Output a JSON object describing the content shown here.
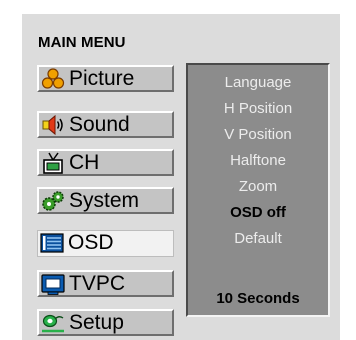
{
  "title": "MAIN MENU",
  "menu": {
    "items": [
      {
        "label": "Picture",
        "icon": "picture-icon",
        "selected": false
      },
      {
        "label": "Sound",
        "icon": "speaker-icon",
        "selected": false
      },
      {
        "label": "CH",
        "icon": "tv-antenna-icon",
        "selected": false
      },
      {
        "label": "System",
        "icon": "gears-icon",
        "selected": false
      },
      {
        "label": "OSD",
        "icon": "osd-icon",
        "selected": true
      },
      {
        "label": "TVPC",
        "icon": "monitor-icon",
        "selected": false
      },
      {
        "label": "Setup",
        "icon": "setup-icon",
        "selected": false
      }
    ]
  },
  "submenu": {
    "items": [
      {
        "label": "Language",
        "active": false
      },
      {
        "label": "H Position",
        "active": false
      },
      {
        "label": "V Position",
        "active": false
      },
      {
        "label": "Halftone",
        "active": false
      },
      {
        "label": "Zoom",
        "active": false
      },
      {
        "label": "OSD off",
        "active": true
      },
      {
        "label": "Default",
        "active": false
      }
    ],
    "timeout_value": "10 Seconds"
  },
  "colors": {
    "panel_bg": "#dcdcdc",
    "button_bg": "#c4c4c4",
    "submenu_bg": "#8c8c8c",
    "submenu_text": "#ececec",
    "submenu_active_text": "#000000"
  }
}
